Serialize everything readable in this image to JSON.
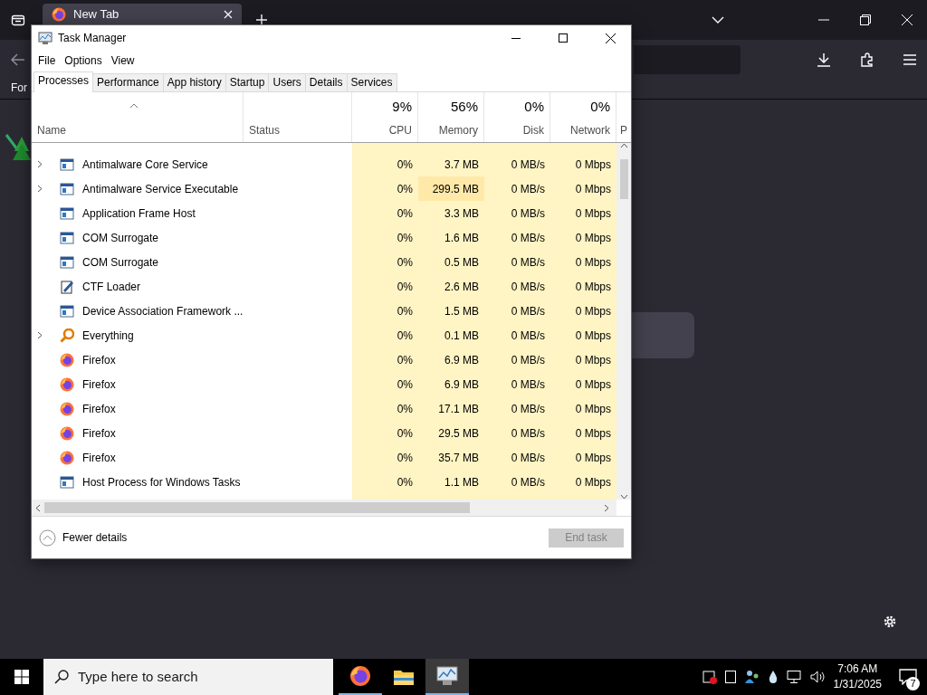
{
  "browser": {
    "tab_title": "New Tab",
    "bookmark_text": "For"
  },
  "task_manager": {
    "title": "Task Manager",
    "menu": [
      "File",
      "Options",
      "View"
    ],
    "tabs": [
      {
        "label": "Processes",
        "selected": true
      },
      {
        "label": "Performance",
        "selected": false
      },
      {
        "label": "App history",
        "selected": false
      },
      {
        "label": "Startup",
        "selected": false
      },
      {
        "label": "Users",
        "selected": false
      },
      {
        "label": "Details",
        "selected": false
      },
      {
        "label": "Services",
        "selected": false
      }
    ],
    "columns": [
      {
        "label": "Name"
      },
      {
        "label": "Status"
      },
      {
        "percent": "9%",
        "label": "CPU"
      },
      {
        "percent": "56%",
        "label": "Memory"
      },
      {
        "percent": "0%",
        "label": "Disk"
      },
      {
        "percent": "0%",
        "label": "Network"
      },
      {
        "label": "P"
      }
    ],
    "rows": [
      {
        "name": "Antimalware Core Service",
        "expandable": true,
        "kind": "app",
        "cpu": "0%",
        "memory": "3.7 MB",
        "memory_high": false,
        "disk": "0 MB/s",
        "network": "0 Mbps"
      },
      {
        "name": "Antimalware Service Executable",
        "expandable": true,
        "kind": "app",
        "cpu": "0%",
        "memory": "299.5 MB",
        "memory_high": true,
        "disk": "0 MB/s",
        "network": "0 Mbps"
      },
      {
        "name": "Application Frame Host",
        "expandable": false,
        "kind": "app",
        "cpu": "0%",
        "memory": "3.3 MB",
        "memory_high": false,
        "disk": "0 MB/s",
        "network": "0 Mbps"
      },
      {
        "name": "COM Surrogate",
        "expandable": false,
        "kind": "app",
        "cpu": "0%",
        "memory": "1.6 MB",
        "memory_high": false,
        "disk": "0 MB/s",
        "network": "0 Mbps"
      },
      {
        "name": "COM Surrogate",
        "expandable": false,
        "kind": "app",
        "cpu": "0%",
        "memory": "0.5 MB",
        "memory_high": false,
        "disk": "0 MB/s",
        "network": "0 Mbps"
      },
      {
        "name": "CTF Loader",
        "expandable": false,
        "kind": "notepad",
        "cpu": "0%",
        "memory": "2.6 MB",
        "memory_high": false,
        "disk": "0 MB/s",
        "network": "0 Mbps"
      },
      {
        "name": "Device Association Framework ...",
        "expandable": false,
        "kind": "app",
        "cpu": "0%",
        "memory": "1.5 MB",
        "memory_high": false,
        "disk": "0 MB/s",
        "network": "0 Mbps"
      },
      {
        "name": "Everything",
        "expandable": true,
        "kind": "magnifier",
        "cpu": "0%",
        "memory": "0.1 MB",
        "memory_high": false,
        "disk": "0 MB/s",
        "network": "0 Mbps"
      },
      {
        "name": "Firefox",
        "expandable": false,
        "kind": "firefox",
        "cpu": "0%",
        "memory": "6.9 MB",
        "memory_high": false,
        "disk": "0 MB/s",
        "network": "0 Mbps"
      },
      {
        "name": "Firefox",
        "expandable": false,
        "kind": "firefox",
        "cpu": "0%",
        "memory": "6.9 MB",
        "memory_high": false,
        "disk": "0 MB/s",
        "network": "0 Mbps"
      },
      {
        "name": "Firefox",
        "expandable": false,
        "kind": "firefox",
        "cpu": "0%",
        "memory": "17.1 MB",
        "memory_high": false,
        "disk": "0 MB/s",
        "network": "0 Mbps"
      },
      {
        "name": "Firefox",
        "expandable": false,
        "kind": "firefox",
        "cpu": "0%",
        "memory": "29.5 MB",
        "memory_high": false,
        "disk": "0 MB/s",
        "network": "0 Mbps"
      },
      {
        "name": "Firefox",
        "expandable": false,
        "kind": "firefox",
        "cpu": "0%",
        "memory": "35.7 MB",
        "memory_high": false,
        "disk": "0 MB/s",
        "network": "0 Mbps"
      },
      {
        "name": "Host Process for Windows Tasks",
        "expandable": false,
        "kind": "app",
        "cpu": "0%",
        "memory": "1.1 MB",
        "memory_high": false,
        "disk": "0 MB/s",
        "network": "0 Mbps"
      }
    ],
    "fewer_details": "Fewer details",
    "end_task": {
      "label": "End task",
      "disabled": true
    }
  },
  "taskbar": {
    "search_placeholder": "Type here to search",
    "apps": [
      {
        "kind": "firefox",
        "running": true,
        "selected": false
      },
      {
        "kind": "explorer",
        "running": false,
        "selected": false
      },
      {
        "kind": "taskmgr",
        "running": true,
        "selected": true
      }
    ],
    "time": "7:06 AM",
    "date": "1/31/2025",
    "notification_count": "7"
  }
}
